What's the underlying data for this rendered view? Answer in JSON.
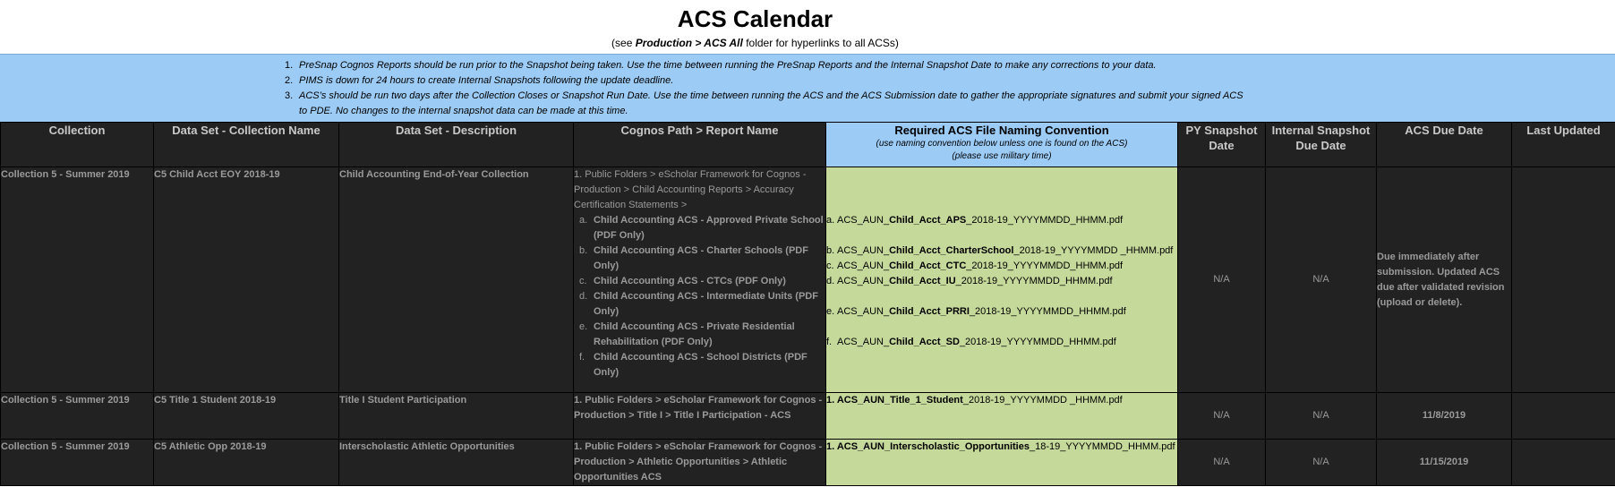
{
  "header": {
    "title": "ACS Calendar",
    "subtitle_pre": "(see ",
    "subtitle_bold": "Production > ACS All",
    "subtitle_post": " folder for hyperlinks to all ACSs)"
  },
  "notes": [
    {
      "num": "1.",
      "text": "PreSnap Cognos Reports should be run prior to the Snapshot being taken. Use the time between running the PreSnap Reports and the Internal Snapshot Date to make any corrections to your data."
    },
    {
      "num": "2.",
      "text": "PIMS is down for 24 hours to create Internal Snapshots following the update deadline."
    },
    {
      "num": "3.",
      "text": "ACS’s should be run two days after the Collection Closes or Snapshot Run Date. Use the time between running the ACS and the ACS Submission date to gather the appropriate signatures and submit your signed ACS to PDE. No changes to the internal snapshot data can be made at this time."
    }
  ],
  "columns": {
    "collection": "Collection",
    "dataset_name": "Data Set - Collection Name",
    "dataset_desc": "Data Set - Description",
    "cognos_path": "Cognos Path > Report Name",
    "req_title": "Required ACS File Naming Convention",
    "req_note1": "(use naming convention below unless one is found on the ACS)",
    "req_note2": "(please use military time)",
    "py_snapshot": "PY Snapshot Date",
    "internal_snapshot": "Internal Snapshot Due Date",
    "acs_due": "ACS Due Date",
    "last_updated": "Last Updated"
  },
  "rows": [
    {
      "collection": "Collection 5 - Summer 2019",
      "dataset_name": "C5 Child Acct EOY 2018-19",
      "dataset_desc": "Child Accounting End-of-Year Collection",
      "path_intro": "1. Public Folders > eScholar Framework for Cognos - Production > Child Accounting Reports > Accuracy Certification Statements >",
      "path_items": [
        {
          "l": "a.",
          "text": "Child Accounting ACS - Approved Private School (PDF Only)"
        },
        {
          "l": "b.",
          "text": "Child Accounting ACS - Charter Schools (PDF Only)"
        },
        {
          "l": "c.",
          "text": "Child Accounting ACS - CTCs (PDF Only)"
        },
        {
          "l": "d.",
          "text": "Child Accounting ACS - Intermediate Units (PDF Only)"
        },
        {
          "l": "e.",
          "text": "Child Accounting ACS - Private Residential Rehabilitation (PDF Only)"
        },
        {
          "l": "f.",
          "text": "Child Accounting ACS - School Districts (PDF Only)"
        }
      ],
      "files": [
        {
          "l": "a.",
          "pre": "ACS_AUN_",
          "bold": "Child_Acct_APS",
          "post": "_2018-19_YYYYMMDD_HHMM.pdf"
        },
        {
          "l": "b.",
          "pre": "ACS_AUN_",
          "bold": "Child_Acct_CharterSchool",
          "post": "_2018-19_YYYYMMDD _HHMM.pdf"
        },
        {
          "l": "c.",
          "pre": "ACS_AUN_",
          "bold": "Child_Acct_CTC",
          "post": "_2018-19_YYYYMMDD_HHMM.pdf"
        },
        {
          "l": "d.",
          "pre": "ACS_AUN_",
          "bold": "Child_Acct_IU",
          "post": "_2018-19_YYYYMMDD_HHMM.pdf"
        },
        {
          "l": "e.",
          "pre": "ACS_AUN_",
          "bold": "Child_Acct_PRRI",
          "post": "_2018-19_YYYYMMDD_HHMM.pdf"
        },
        {
          "l": "f.",
          "pre": "ACS_AUN_",
          "bold": "Child_Acct_SD",
          "post": "_2018-19_YYYYMMDD_HHMM.pdf"
        }
      ],
      "py_snapshot": "N/A",
      "internal_snapshot": "N/A",
      "acs_due": "Due immediately after submission. Updated ACS due after validated revision (upload or delete).",
      "last_updated": ""
    },
    {
      "collection": "Collection 5 - Summer 2019",
      "dataset_name": "C5 Title 1 Student 2018-19",
      "dataset_desc": "Title I Student Participation",
      "path": "1. Public Folders > eScholar Framework for Cognos - Production > Title I > Title I Participation - ACS",
      "file_pre": "1. ACS_AUN_Title_1_Student",
      "file_post": "_2018-19_YYYYMMDD _HHMM.pdf",
      "py_snapshot": "N/A",
      "internal_snapshot": "N/A",
      "acs_due": "11/8/2019",
      "last_updated": ""
    },
    {
      "collection": "Collection 5 - Summer 2019",
      "dataset_name": "C5 Athletic Opp 2018-19",
      "dataset_desc": "Interscholastic Athletic Opportunities",
      "path": "1. Public Folders > eScholar Framework for Cognos - Production > Athletic Opportunities > Athletic Opportunities ACS",
      "file_pre": "1. ACS_AUN_Interscholastic_Opportunities",
      "file_post": "_18-19_YYYYMMDD_HHMM.pdf",
      "py_snapshot": "N/A",
      "internal_snapshot": "N/A",
      "acs_due": "11/15/2019",
      "last_updated": ""
    }
  ]
}
